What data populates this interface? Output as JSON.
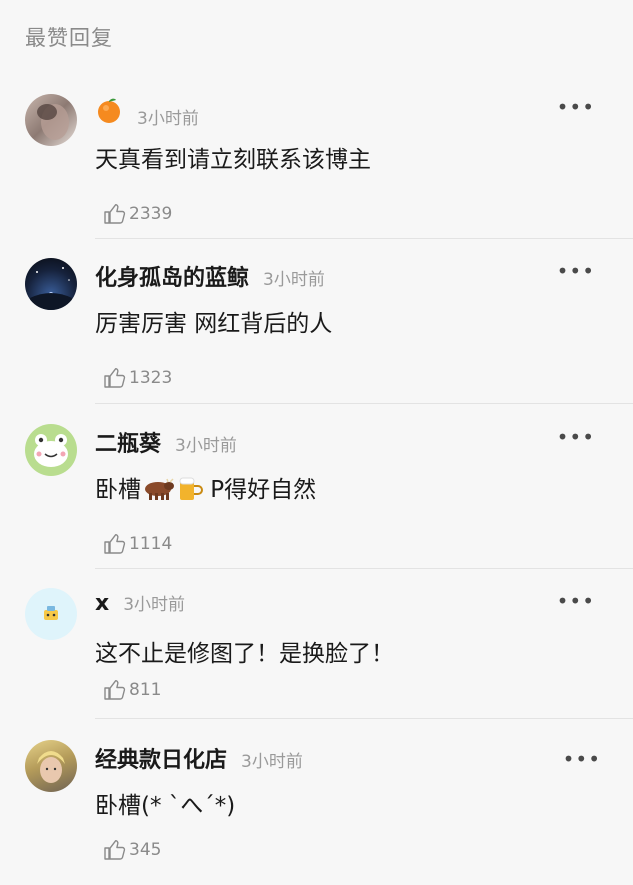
{
  "header": {
    "title": "最赞回复"
  },
  "comments": [
    {
      "name": "",
      "name_emoji": "orange-icon",
      "time": "3小时前",
      "text": "天真看到请立刻联系该博主",
      "likes": "2339",
      "avatar": "avatar-photo-1"
    },
    {
      "name": "化身孤岛的蓝鲸",
      "time": "3小时前",
      "text": "厉害厉害 网红背后的人",
      "likes": "1323",
      "avatar": "avatar-night-sky"
    },
    {
      "name": "二瓶葵",
      "time": "3小时前",
      "text_prefix": "卧槽",
      "text_suffix": " P得好自然",
      "text_emojis": [
        "cow-emoji",
        "beer-emoji"
      ],
      "likes": "1114",
      "avatar": "avatar-frog"
    },
    {
      "name": "x",
      "time": "3小时前",
      "text": "这不止是修图了！是换脸了！",
      "likes": "811",
      "avatar": "avatar-cartoon"
    },
    {
      "name": "经典款日化店",
      "time": "3小时前",
      "text": "卧槽(* `へ´*)",
      "likes": "345",
      "avatar": "avatar-person"
    }
  ],
  "more_label": "•••"
}
